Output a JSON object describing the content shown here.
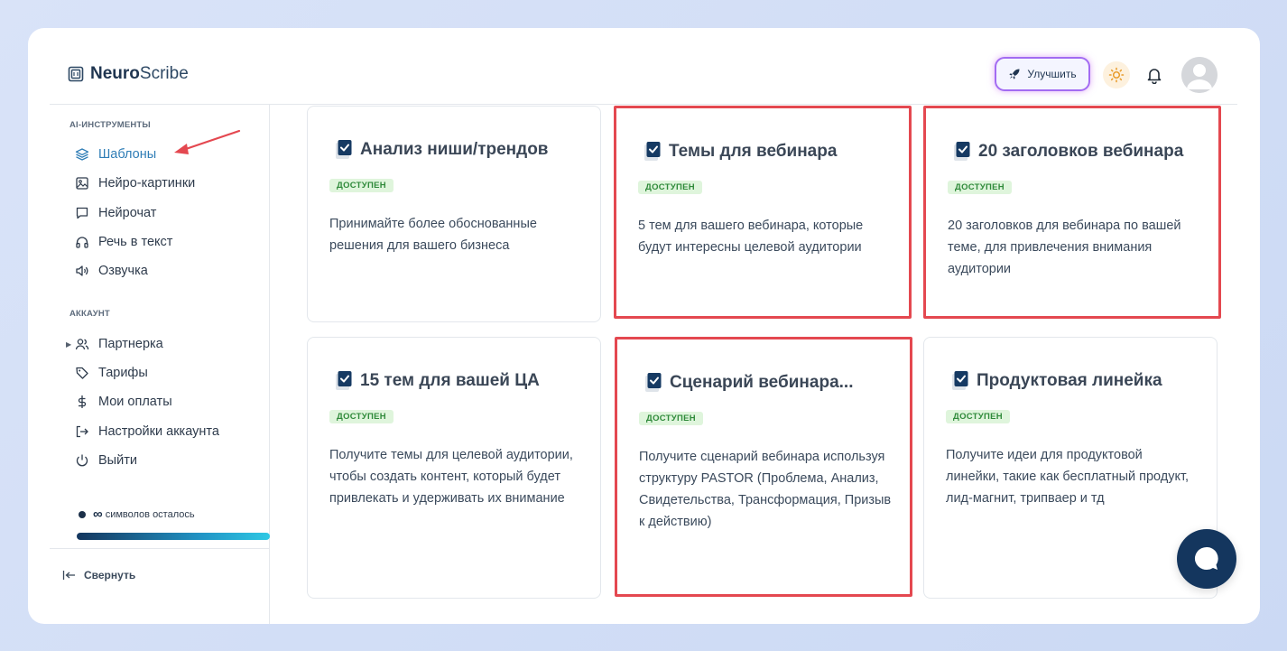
{
  "header": {
    "brand_bold": "Neuro",
    "brand_light": "Scribe",
    "upgrade_label": "Улучшить"
  },
  "sidebar": {
    "section_tools": "AI-ИНСТРУМЕНТЫ",
    "tools": [
      {
        "label": "Шаблоны",
        "icon": "layers-icon",
        "active": true
      },
      {
        "label": "Нейро-картинки",
        "icon": "image-icon"
      },
      {
        "label": "Нейрочат",
        "icon": "chat-bubble-icon"
      },
      {
        "label": "Речь в текст",
        "icon": "headphones-icon"
      },
      {
        "label": "Озвучка",
        "icon": "speaker-icon"
      }
    ],
    "section_account": "АККАУНТ",
    "account": [
      {
        "label": "Партнерка",
        "icon": "users-icon"
      },
      {
        "label": "Тарифы",
        "icon": "tag-icon"
      },
      {
        "label": "Мои оплаты",
        "icon": "dollar-icon"
      },
      {
        "label": "Настройки аккаунта",
        "icon": "logout-box-icon"
      },
      {
        "label": "Выйти",
        "icon": "power-icon"
      }
    ],
    "symbols_infinity": "∞",
    "symbols_label": "символов осталось",
    "symbols_progress": 1.0,
    "collapse_label": "Свернуть"
  },
  "cards": [
    {
      "title": "Анализ ниши/трендов",
      "badge": "ДОСТУПЕН",
      "desc": "Принимайте более обоснованные решения для вашего бизнеса"
    },
    {
      "title": "Темы для вебинара",
      "badge": "ДОСТУПЕН",
      "desc": "5 тем для вашего вебинара, которые будут интересны целевой аудитории"
    },
    {
      "title": "20 заголовков вебинара",
      "badge": "ДОСТУПЕН",
      "desc": "20 заголовков для вебинара по вашей теме, для привлечения внимания аудитории"
    },
    {
      "title": "15 тем для вашей ЦА",
      "badge": "ДОСТУПЕН",
      "desc": "Получите темы для целевой аудитории, чтобы создать контент, который будет привлекать и удерживать их внимание"
    },
    {
      "title": "Сценарий вебинара...",
      "badge": "ДОСТУПЕН",
      "desc": "Получите сценарий вебинара используя структуру PASTOR (Проблема, Анализ, Свидетельства, Трансформация, Призыв к действию)"
    },
    {
      "title": "Продуктовая линейка",
      "badge": "ДОСТУПЕН",
      "desc": "Получите идеи для продуктовой линейки, такие как бесплатный продукт, лид-магнит, трипваер и тд"
    }
  ],
  "colors": {
    "accent": "#2f7db6",
    "navy": "#14365e",
    "highlight": "#e44850",
    "badge_bg": "#dff5dc",
    "badge_text": "#2f8a3a"
  }
}
